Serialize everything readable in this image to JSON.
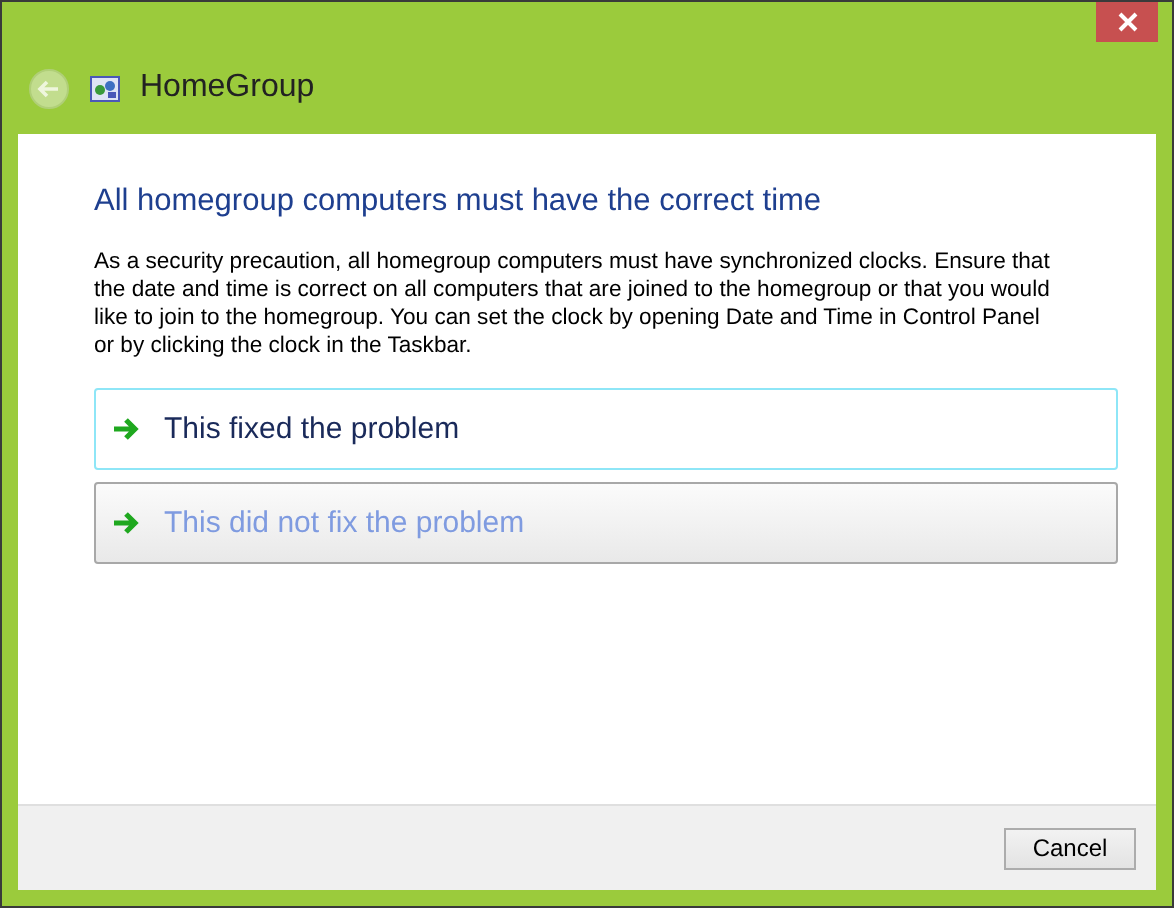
{
  "window": {
    "title": "HomeGroup"
  },
  "heading": "All homegroup computers must have the correct time",
  "description": "As a security precaution, all homegroup computers must have synchronized clocks. Ensure that the date and time is correct on all computers that are joined to the homegroup or that you would like to join to the homegroup. You can set the clock by opening Date and Time in Control Panel or by clicking the clock in the Taskbar.",
  "options": [
    {
      "label": "This fixed the problem",
      "hovered": true,
      "disabled": false
    },
    {
      "label": "This did not fix the problem",
      "hovered": false,
      "disabled": true
    }
  ],
  "buttons": [
    {
      "label": "Cancel"
    }
  ]
}
